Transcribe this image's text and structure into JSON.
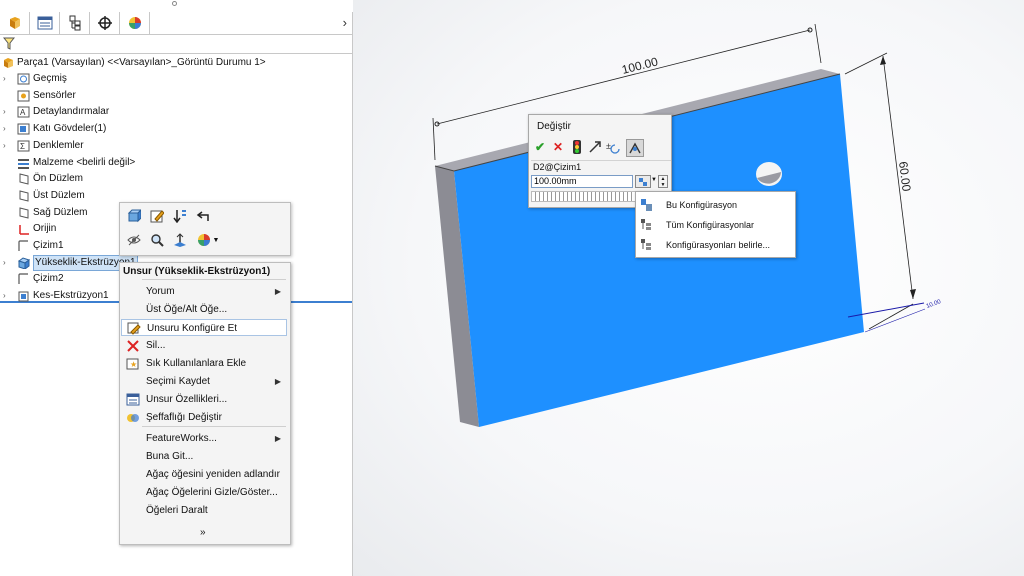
{
  "feature_tree": {
    "root_label": "Parça1 (Varsayılan) <<Varsayılan>_Görüntü Durumu 1>",
    "items": [
      {
        "label": "Geçmiş",
        "icon": "history-icon",
        "expandable": true
      },
      {
        "label": "Sensörler",
        "icon": "sensor-icon",
        "expandable": false
      },
      {
        "label": "Detaylandırmalar",
        "icon": "annotation-icon",
        "expandable": true
      },
      {
        "label": "Katı Gövdeler(1)",
        "icon": "solid-body-icon",
        "expandable": true
      },
      {
        "label": "Denklemler",
        "icon": "equation-icon",
        "expandable": true
      },
      {
        "label": "Malzeme <belirli değil>",
        "icon": "material-icon",
        "expandable": false
      },
      {
        "label": "Ön Düzlem",
        "icon": "plane-icon",
        "expandable": false
      },
      {
        "label": "Üst Düzlem",
        "icon": "plane-icon",
        "expandable": false
      },
      {
        "label": "Sağ Düzlem",
        "icon": "plane-icon",
        "expandable": false
      },
      {
        "label": "Orijin",
        "icon": "origin-icon",
        "expandable": false
      },
      {
        "label": "Çizim1",
        "icon": "sketch-icon",
        "expandable": false
      },
      {
        "label": "Yükseklik-Ekstrüzyon1",
        "icon": "extrude-icon",
        "expandable": true,
        "selected": true
      },
      {
        "label": "Çizim2",
        "icon": "sketch-icon",
        "expandable": false
      },
      {
        "label": "Kes-Ekstrüzyon1",
        "icon": "cut-extrude-icon",
        "expandable": true
      }
    ]
  },
  "context_menu": {
    "title": "Unsur (Yükseklik-Ekstrüzyon1)",
    "items": [
      {
        "label": "Yorum",
        "submenu": true
      },
      {
        "label": "Üst Öğe/Alt Öğe...",
        "submenu": false
      },
      {
        "label": "Unsuru Konfigüre Et",
        "submenu": false,
        "highlighted": true
      },
      {
        "label": "Sil...",
        "submenu": false
      },
      {
        "label": "Sık Kullanılanlara Ekle",
        "submenu": false
      },
      {
        "label": "Seçimi Kaydet",
        "submenu": true
      },
      {
        "label": "Unsur Özellikleri...",
        "submenu": false
      },
      {
        "label": "Şeffaflığı Değiştir",
        "submenu": false
      },
      {
        "label": "FeatureWorks...",
        "submenu": true
      },
      {
        "label": "Buna Git...",
        "submenu": false
      },
      {
        "label": "Ağaç öğesini yeniden adlandır",
        "submenu": false
      },
      {
        "label": "Ağaç Öğelerini Gizle/Göster...",
        "submenu": false
      },
      {
        "label": "Öğeleri Daralt",
        "submenu": false
      }
    ],
    "more_glyph": "»"
  },
  "modify_dialog": {
    "title": "Değiştir",
    "dimension_name": "D2@Çizim1",
    "value": "100.00mm",
    "buttons": [
      "ok-icon",
      "cancel-icon",
      "rebuild-icon",
      "reverse-icon",
      "spin-increment-icon",
      "mark-dimension-icon"
    ]
  },
  "config_dropdown": {
    "items": [
      "Bu Konfigürasyon",
      "Tüm Konfigürasyonlar",
      "Konfigürasyonları belirle..."
    ]
  },
  "dimensions": {
    "width": "100.00",
    "height": "60.00",
    "depth": "10.00"
  },
  "colors": {
    "face_blue": "#1e90ff",
    "side_gray": "#8c8c94",
    "dim_line": "#222222",
    "selection": "#cfe3f7"
  }
}
